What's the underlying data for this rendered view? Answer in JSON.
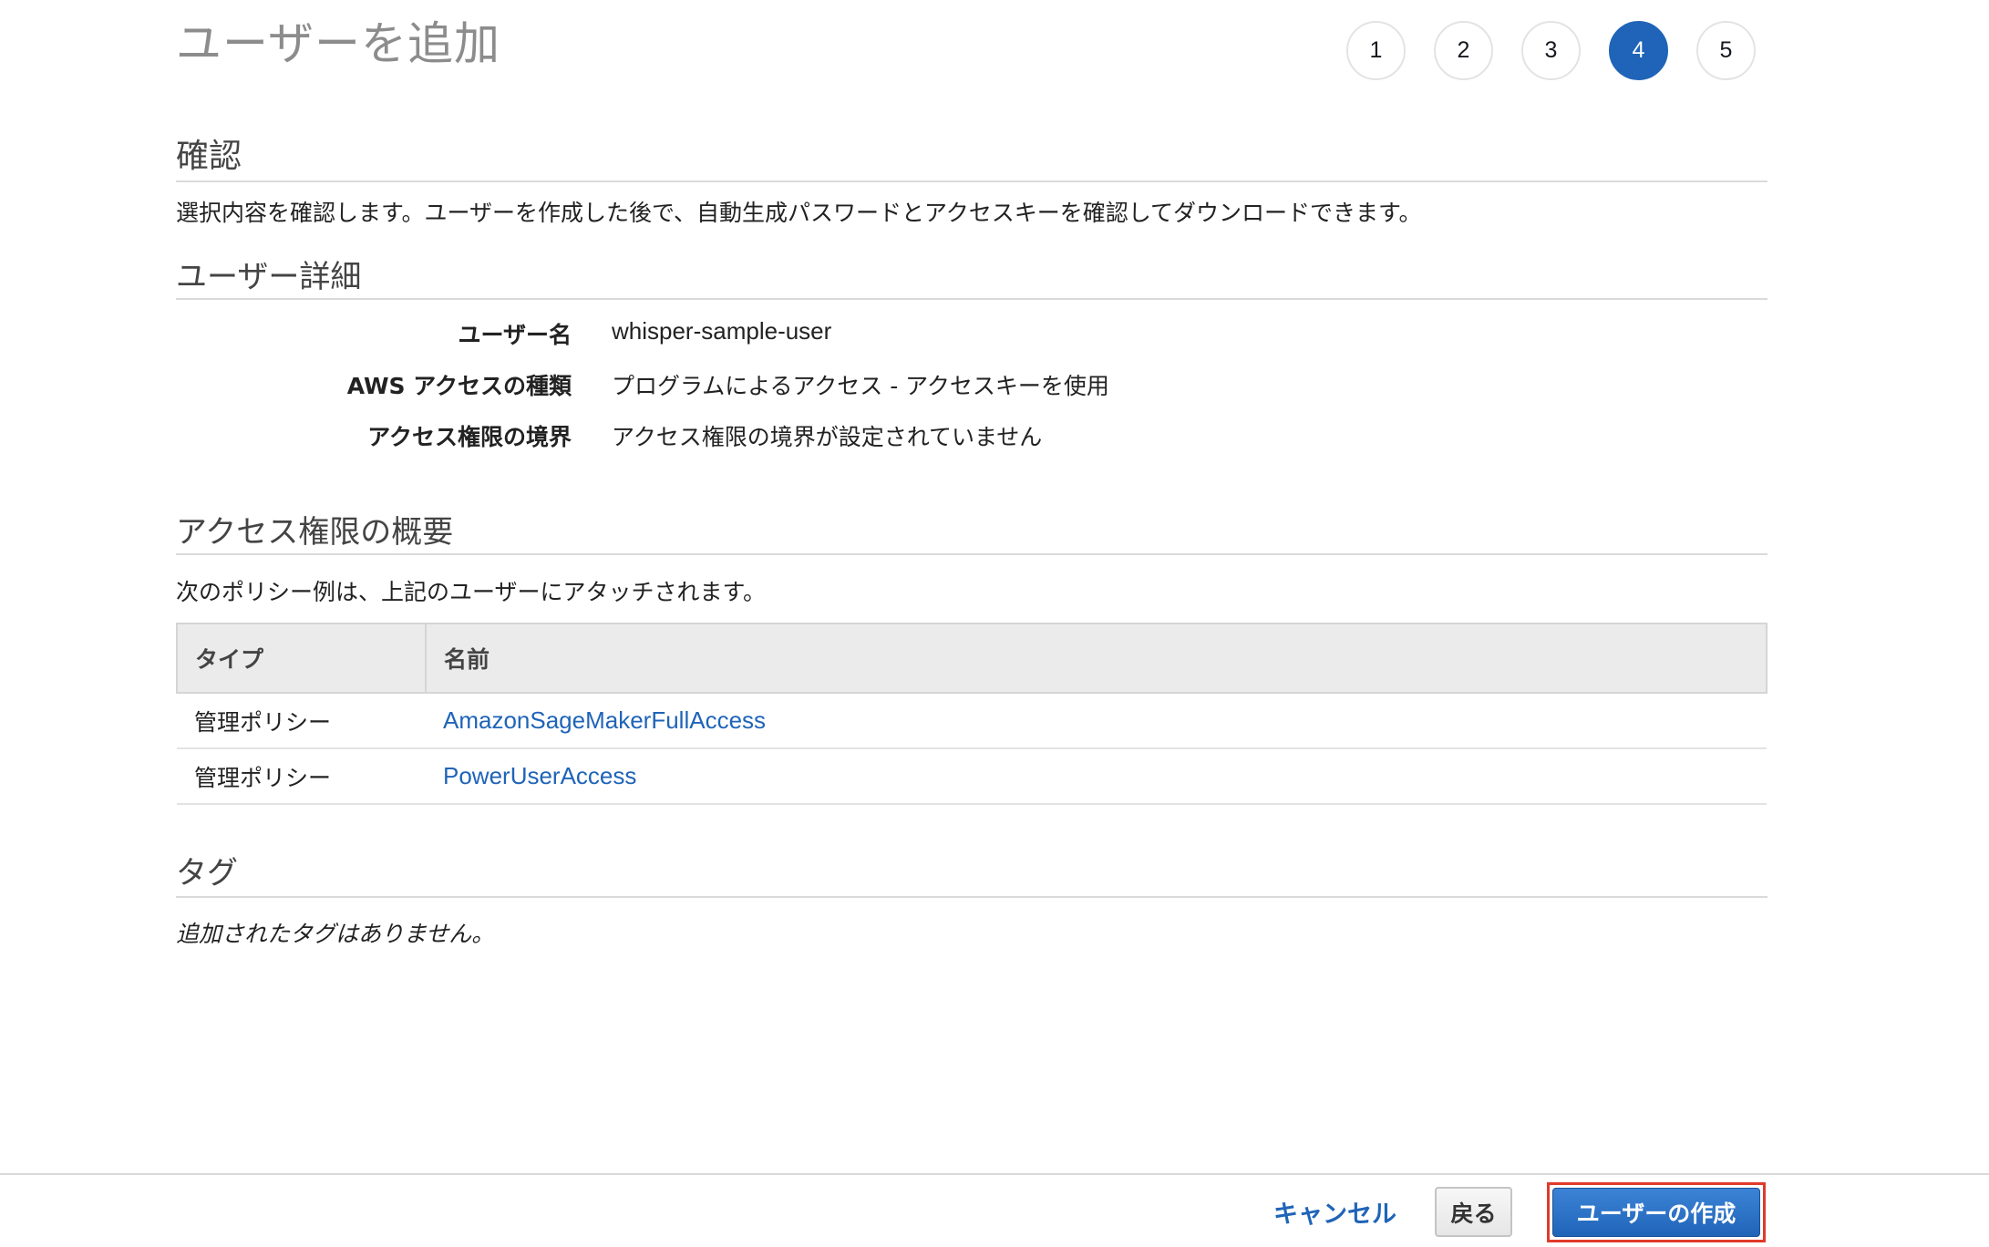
{
  "page_title": "ユーザーを追加",
  "steps": [
    {
      "label": "1",
      "active": false
    },
    {
      "label": "2",
      "active": false
    },
    {
      "label": "3",
      "active": false
    },
    {
      "label": "4",
      "active": true
    },
    {
      "label": "5",
      "active": false
    }
  ],
  "review": {
    "title": "確認",
    "description": "選択内容を確認します。ユーザーを作成した後で、自動生成パスワードとアクセスキーを確認してダウンロードできます。"
  },
  "user_details": {
    "title": "ユーザー詳細",
    "rows": [
      {
        "label": "ユーザー名",
        "value": "whisper-sample-user"
      },
      {
        "label": "AWS アクセスの種類",
        "value": "プログラムによるアクセス - アクセスキーを使用"
      },
      {
        "label": "アクセス権限の境界",
        "value": "アクセス権限の境界が設定されていません"
      }
    ]
  },
  "permissions": {
    "title": "アクセス権限の概要",
    "description": "次のポリシー例は、上記のユーザーにアタッチされます。",
    "columns": [
      "タイプ",
      "名前"
    ],
    "rows": [
      {
        "type": "管理ポリシー",
        "name": "AmazonSageMakerFullAccess"
      },
      {
        "type": "管理ポリシー",
        "name": "PowerUserAccess"
      }
    ]
  },
  "tags": {
    "title": "タグ",
    "empty_text": "追加されたタグはありません。"
  },
  "footer": {
    "cancel_label": "キャンセル",
    "back_label": "戻る",
    "create_label": "ユーザーの作成"
  },
  "colors": {
    "accent": "#1f64b8",
    "highlight_border": "#e13a2a"
  }
}
